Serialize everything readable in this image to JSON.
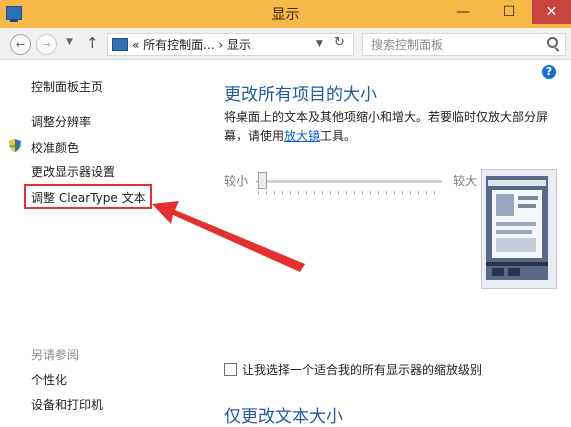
{
  "window": {
    "title": "显示",
    "min": "—",
    "max": "☐",
    "close": "✕"
  },
  "nav": {
    "back": "←",
    "forward": "→",
    "up": "↑",
    "breadcrumb": "«  所有控制面...  ›  显示",
    "refresh": "↻",
    "search_placeholder": "搜索控制面板"
  },
  "sidebar": {
    "home": "控制面板主页",
    "items": [
      "调整分辨率",
      "校准颜色",
      "更改显示器设置",
      "调整 ClearType 文本"
    ],
    "see_also_title": "另请参阅",
    "see_also": [
      "个性化",
      "设备和打印机"
    ]
  },
  "main": {
    "help": "?",
    "heading": "更改所有项目的大小",
    "desc_before": "将桌面上的文本及其他项缩小和增大。若要临时仅放大部分屏幕，请使用",
    "desc_link": "放大镜",
    "desc_after": "工具。",
    "slider_min": "较小",
    "slider_max": "较大",
    "slider_value": 0,
    "checkbox_label": "让我选择一个适合我的所有显示器的缩放级别",
    "checkbox_checked": false,
    "heading2": "仅更改文本大小"
  },
  "colors": {
    "accent": "#1f5aa0",
    "titlebar": "#f6b949",
    "highlight": "#e53030",
    "link": "#0a5fc5"
  }
}
